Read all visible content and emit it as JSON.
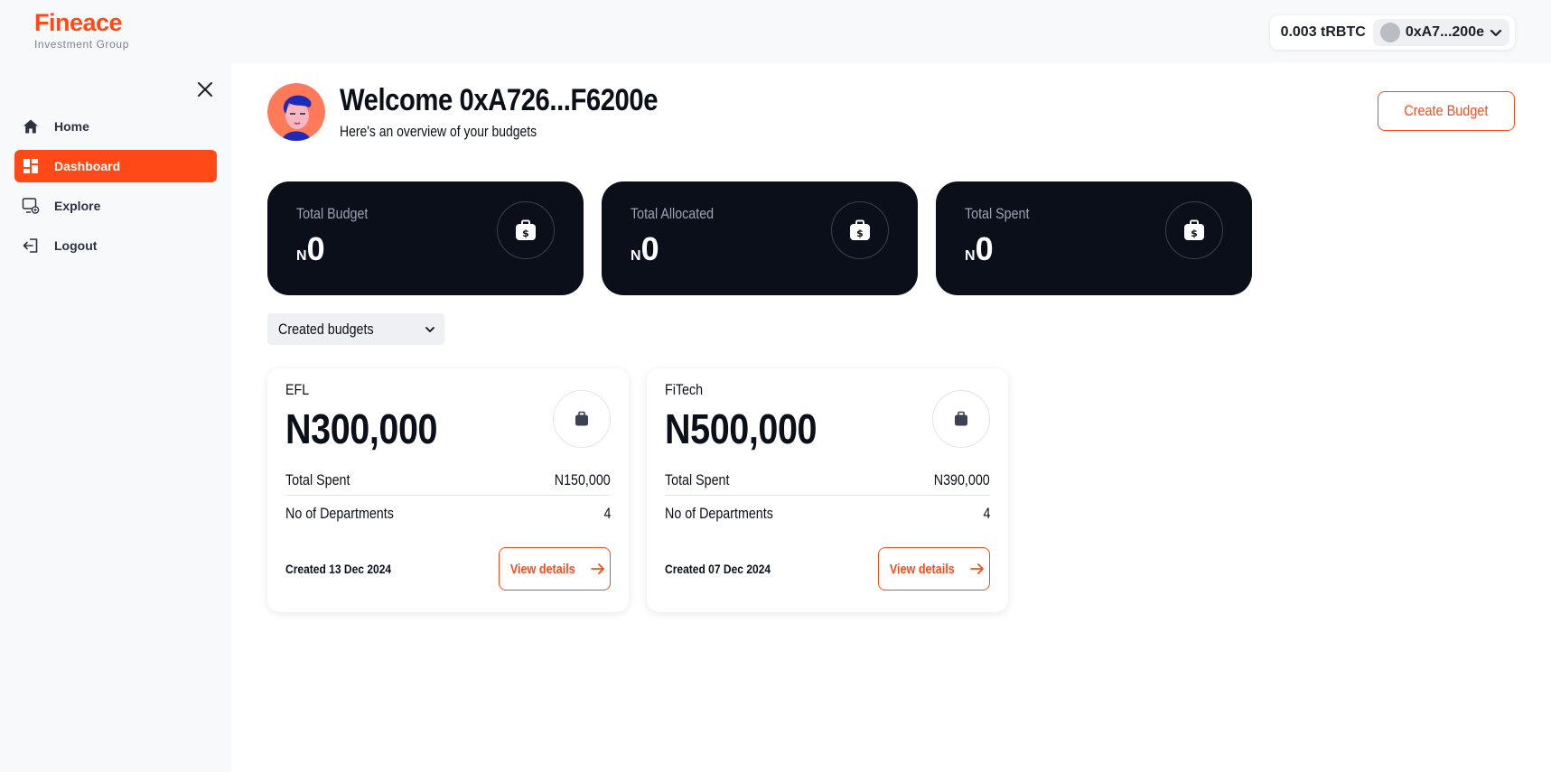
{
  "brand": {
    "name": "Fineace",
    "tagline": "Investment Group"
  },
  "wallet": {
    "balance": "0.003 tRBTC",
    "address": "0xA7...200e"
  },
  "sidebar": {
    "items": [
      {
        "label": "Home",
        "icon": "home-icon"
      },
      {
        "label": "Dashboard",
        "icon": "dashboard-icon",
        "active": true
      },
      {
        "label": "Explore",
        "icon": "explore-icon"
      },
      {
        "label": "Logout",
        "icon": "logout-icon"
      }
    ]
  },
  "header": {
    "title": "Welcome 0xA726...F6200e",
    "subtitle": "Here's an overview of your budgets",
    "create_button": "Create Budget"
  },
  "stats": [
    {
      "label": "Total Budget",
      "currency": "N",
      "value": "0"
    },
    {
      "label": "Total Allocated",
      "currency": "N",
      "value": "0"
    },
    {
      "label": "Total Spent",
      "currency": "N",
      "value": "0"
    }
  ],
  "filter": {
    "selected": "Created budgets"
  },
  "budgets": [
    {
      "name": "EFL",
      "amount": "N300,000",
      "spent_label": "Total Spent",
      "spent_value": "N150,000",
      "dept_label": "No of Departments",
      "dept_value": "4",
      "created": "Created 13 Dec 2024",
      "button": "View details"
    },
    {
      "name": "FiTech",
      "amount": "N500,000",
      "spent_label": "Total Spent",
      "spent_value": "N390,000",
      "dept_label": "No of Departments",
      "dept_value": "4",
      "created": "Created 07 Dec 2024",
      "button": "View details"
    }
  ],
  "colors": {
    "accent": "#ff4a17",
    "dark": "#0b0f1a",
    "sidebar_bg": "#f8f9fb"
  }
}
